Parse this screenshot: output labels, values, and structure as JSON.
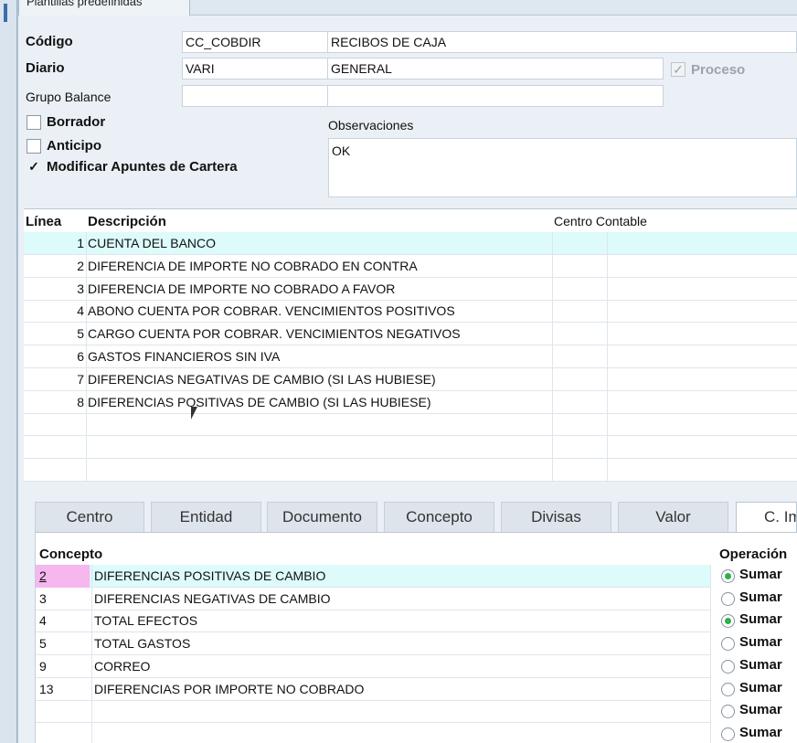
{
  "top_tab": {
    "label": "Plantillas predefinidas"
  },
  "header": {
    "codigo_label": "Código",
    "codigo_value": "CC_COBDIR",
    "codigo_desc": "RECIBOS DE CAJA",
    "diario_label": "Diario",
    "diario_value": "VARI",
    "diario_desc": "GENERAL",
    "proceso_label": "Proceso",
    "proceso_checked": true,
    "grupo_label": "Grupo Balance",
    "grupo_value": "",
    "grupo_desc": ""
  },
  "checkboxes": {
    "borrador_label": "Borrador",
    "borrador_checked": false,
    "anticipo_label": "Anticipo",
    "anticipo_checked": false,
    "modificar_label": "Modificar Apuntes de Cartera",
    "modificar_checked": true
  },
  "observaciones": {
    "label": "Observaciones",
    "value": "OK"
  },
  "lines_grid": {
    "col_linea": "Línea",
    "col_descripcion": "Descripción",
    "col_centro": "Centro Contable",
    "rows": [
      {
        "linea": "1",
        "descripcion": "CUENTA DEL BANCO"
      },
      {
        "linea": "2",
        "descripcion": "DIFERENCIA DE IMPORTE NO COBRADO EN CONTRA"
      },
      {
        "linea": "3",
        "descripcion": "DIFERENCIA DE IMPORTE NO COBRADO A FAVOR"
      },
      {
        "linea": "4",
        "descripcion": "ABONO CUENTA POR COBRAR. VENCIMIENTOS POSITIVOS"
      },
      {
        "linea": "5",
        "descripcion": "CARGO CUENTA POR COBRAR. VENCIMIENTOS NEGATIVOS"
      },
      {
        "linea": "6",
        "descripcion": "GASTOS FINANCIEROS SIN IVA"
      },
      {
        "linea": "7",
        "descripcion": "DIFERENCIAS NEGATIVAS DE CAMBIO (SI LAS HUBIESE)"
      },
      {
        "linea": "8",
        "descripcion": "DIFERENCIAS POSITIVAS DE CAMBIO (SI LAS HUBIESE)"
      }
    ]
  },
  "tabs": [
    {
      "label": "Centro"
    },
    {
      "label": "Entidad"
    },
    {
      "label": "Documento"
    },
    {
      "label": "Concepto"
    },
    {
      "label": "Divisas"
    },
    {
      "label": "Valor"
    },
    {
      "label": "C. Im"
    }
  ],
  "concept_grid": {
    "col_concepto": "Concepto",
    "col_operacion": "Operación",
    "rows": [
      {
        "code": "2",
        "name": "DIFERENCIAS POSITIVAS DE CAMBIO",
        "op": "Sumar",
        "selected": true
      },
      {
        "code": "3",
        "name": "DIFERENCIAS NEGATIVAS DE CAMBIO",
        "op": "Sumar",
        "selected": false
      },
      {
        "code": "4",
        "name": "TOTAL EFECTOS",
        "op": "Sumar",
        "selected": true
      },
      {
        "code": "5",
        "name": "TOTAL GASTOS",
        "op": "Sumar",
        "selected": false
      },
      {
        "code": "9",
        "name": "CORREO",
        "op": "Sumar",
        "selected": false
      },
      {
        "code": "13",
        "name": "DIFERENCIAS POR IMPORTE NO COBRADO",
        "op": "Sumar",
        "selected": false
      },
      {
        "code": "",
        "name": "",
        "op": "Sumar",
        "selected": false
      },
      {
        "code": "",
        "name": "",
        "op": "Sumar",
        "selected": false
      }
    ]
  },
  "colors": {
    "selected_row": "#ddfbfb",
    "code_highlight": "#f6b6ee",
    "radio_on": "#2bb24c"
  }
}
